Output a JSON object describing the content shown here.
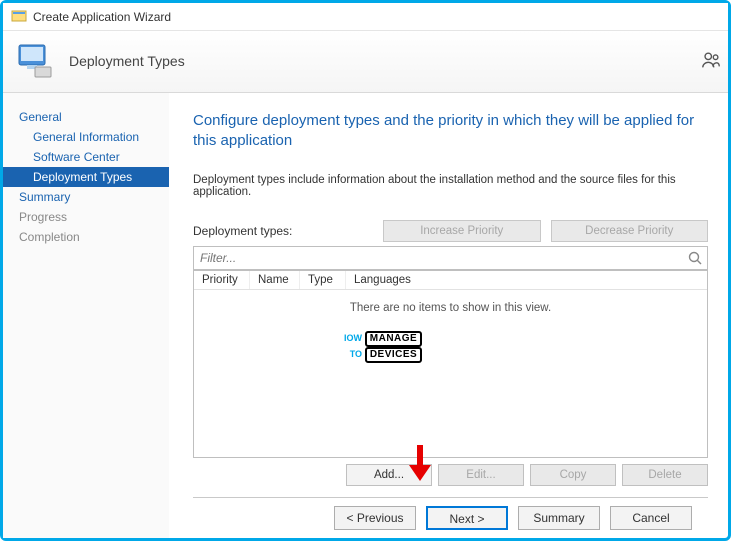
{
  "window": {
    "title": "Create Application Wizard"
  },
  "header": {
    "page_title": "Deployment Types"
  },
  "sidebar": {
    "items": [
      {
        "label": "General"
      },
      {
        "label": "General Information"
      },
      {
        "label": "Software Center"
      },
      {
        "label": "Deployment Types"
      },
      {
        "label": "Summary"
      },
      {
        "label": "Progress"
      },
      {
        "label": "Completion"
      }
    ]
  },
  "main": {
    "heading": "Configure deployment types and the priority in which they will be applied for this application",
    "description": "Deployment types include information about the installation method and the source files for this application.",
    "dt_label": "Deployment types:",
    "increase_btn": "Increase Priority",
    "decrease_btn": "Decrease Priority",
    "filter_placeholder": "Filter...",
    "columns": {
      "priority": "Priority",
      "name": "Name",
      "type": "Type",
      "languages": "Languages"
    },
    "empty_text": "There are no items to show in this view.",
    "actions": {
      "add": "Add...",
      "edit": "Edit...",
      "copy": "Copy",
      "delete": "Delete"
    }
  },
  "footer": {
    "previous": "< Previous",
    "next": "Next >",
    "summary": "Summary",
    "cancel": "Cancel"
  },
  "watermark": {
    "l1a": "IOW",
    "l1b": "MANAGE",
    "l2a": "TO",
    "l2b": "DEVICES"
  }
}
